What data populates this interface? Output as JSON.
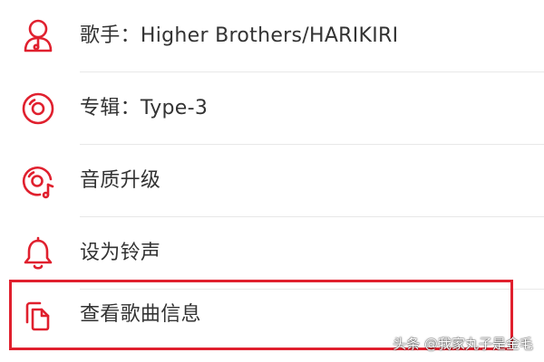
{
  "colors": {
    "accent": "#e0202e",
    "text": "#333333",
    "divider": "#e8e8e8",
    "highlight": "#e0202e"
  },
  "menu": {
    "items": [
      {
        "icon": "singer-icon",
        "label": "歌手：Higher Brothers/HARIKIRI"
      },
      {
        "icon": "album-icon",
        "label": "专辑：Type-3"
      },
      {
        "icon": "quality-upgrade-icon",
        "label": "音质升级"
      },
      {
        "icon": "bell-icon",
        "label": "设为铃声"
      },
      {
        "icon": "copy-icon",
        "label": "查看歌曲信息"
      }
    ]
  },
  "watermark": "头条 @我家丸子是金毛"
}
